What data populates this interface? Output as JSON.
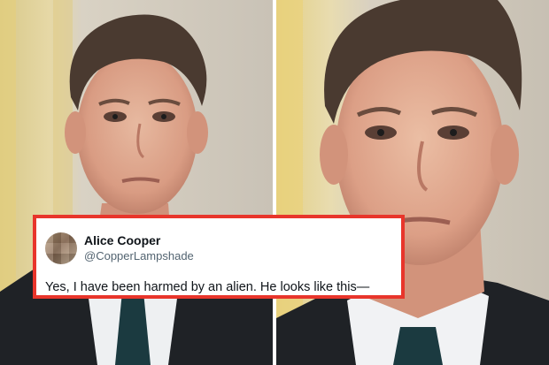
{
  "tweet": {
    "display_name": "Alice Cooper",
    "handle": "@CopperLampshade",
    "text": "Yes, I have been harmed by an alien. He looks like this—"
  },
  "colors": {
    "card_border": "#e8352b",
    "text_primary": "#0f1419",
    "text_secondary": "#536471"
  },
  "icons": {
    "avatar": "pixelated-avatar-icon"
  }
}
